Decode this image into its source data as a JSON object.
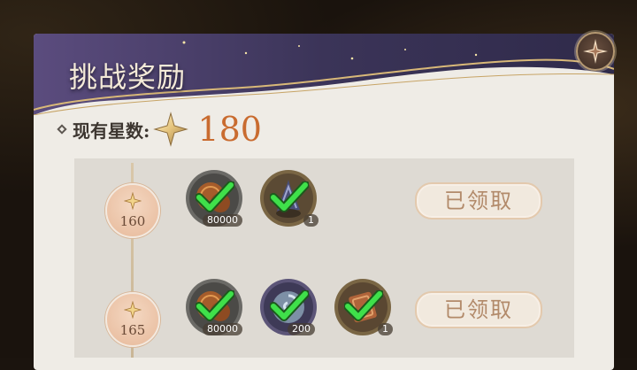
{
  "header": {
    "title": "挑战奖励",
    "close_icon": "ornate-star-icon"
  },
  "stars": {
    "label": "现有星数:",
    "value": "180",
    "value_color": "#c96b2f"
  },
  "tiers": [
    {
      "threshold": "160",
      "rewards": [
        {
          "icon": "coin-reward-icon",
          "quantity": "80000",
          "claimed": true
        },
        {
          "icon": "plant-reward-icon",
          "quantity": "1",
          "claimed": true
        }
      ],
      "button_label": "已领取"
    },
    {
      "threshold": "165",
      "rewards": [
        {
          "icon": "coin-reward-icon",
          "quantity": "80000",
          "claimed": true
        },
        {
          "icon": "swirl-orb-reward-icon",
          "quantity": "200",
          "claimed": true
        },
        {
          "icon": "scroll-reward-icon",
          "quantity": "1",
          "claimed": true
        }
      ],
      "button_label": "已领取"
    }
  ],
  "colors": {
    "check": "#3fe04a",
    "banner": "#3b3458",
    "panel": "#efece6"
  }
}
